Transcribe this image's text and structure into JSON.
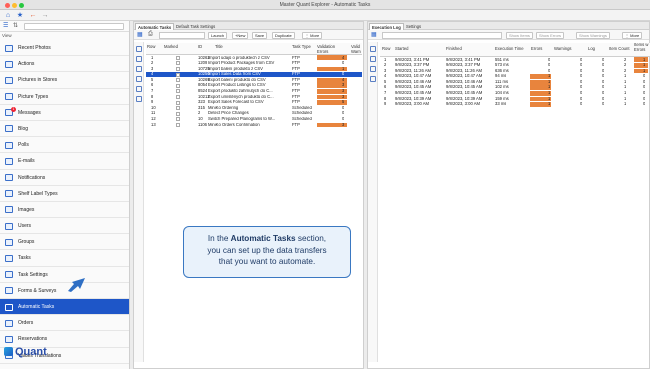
{
  "window": {
    "title": "Master Quant Explorer - Automatic Tasks"
  },
  "sidebar": {
    "view_label": "View",
    "items": [
      {
        "label": "Recent Photos",
        "icon": "photos-icon"
      },
      {
        "label": "Actions",
        "icon": "actions-icon"
      },
      {
        "label": "Pictures in Stores",
        "icon": "store-pictures-icon"
      },
      {
        "label": "Picture Types",
        "icon": "picture-types-icon"
      },
      {
        "label": "Messages",
        "icon": "messages-icon",
        "badge": "1"
      },
      {
        "label": "Blog",
        "icon": "blog-icon"
      },
      {
        "label": "Polls",
        "icon": "polls-icon"
      },
      {
        "label": "E-mails",
        "icon": "email-icon"
      },
      {
        "label": "Notifications",
        "icon": "notifications-icon"
      },
      {
        "label": "Shelf Label Types",
        "icon": "shelf-label-icon"
      },
      {
        "label": "Images",
        "icon": "images-icon"
      },
      {
        "label": "Users",
        "icon": "users-icon"
      },
      {
        "label": "Groups",
        "icon": "groups-icon"
      },
      {
        "label": "Tasks",
        "icon": "tasks-icon"
      },
      {
        "label": "Task Settings",
        "icon": "task-settings-icon"
      },
      {
        "label": "Forms & Surveys",
        "icon": "forms-icon"
      },
      {
        "label": "Automatic Tasks",
        "icon": "automatic-tasks-icon",
        "active": true
      },
      {
        "label": "Orders",
        "icon": "orders-icon"
      },
      {
        "label": "Reservations",
        "icon": "reservations-icon"
      },
      {
        "label": "Values Translations",
        "icon": "translations-icon"
      }
    ],
    "logo_text": "Quant"
  },
  "middle": {
    "tabs": [
      "Automatic Tasks",
      "Default Task Settings"
    ],
    "toolbar": {
      "launch": "Launch",
      "new": "New",
      "save": "Save",
      "duplicate": "Duplicate",
      "more": "More"
    },
    "columns": {
      "row": "Row",
      "marked": "Marked",
      "id": "ID",
      "title": "Title",
      "task_type": "Task Type",
      "validation_errors": "Validation Errors",
      "valid_warn": "Valid Warn"
    },
    "rows": [
      {
        "row": "1",
        "id": "10262",
        "title": "Import údajů o produktech z CSV",
        "type": "FTP",
        "errors": "4"
      },
      {
        "row": "2",
        "id": "1209",
        "title": "Import Product Packages from CSV",
        "type": "FTP",
        "errors": "0"
      },
      {
        "row": "3",
        "id": "10725",
        "title": "Import balení produktů z CSV",
        "type": "FTP",
        "errors": "1"
      },
      {
        "row": "4",
        "id": "10250",
        "title": "Import Sales Data from CSV",
        "type": "FTP",
        "errors": "0",
        "selected": true
      },
      {
        "row": "5",
        "id": "10269",
        "title": "Export balení produktů do CSV",
        "type": "FTP",
        "errors": "4"
      },
      {
        "row": "6",
        "id": "8054",
        "title": "Export Product Listings to CSV",
        "type": "FTP",
        "errors": "3"
      },
      {
        "row": "7",
        "id": "8524",
        "title": "Export produktů zahrnutých do C...",
        "type": "FTP",
        "errors": "3"
      },
      {
        "row": "8",
        "id": "10212",
        "title": "Export umístěných produktů do C...",
        "type": "FTP",
        "errors": "3"
      },
      {
        "row": "9",
        "id": "323",
        "title": "Export Sales Forecast to CSV",
        "type": "FTP",
        "errors": "5"
      },
      {
        "row": "10",
        "id": "315",
        "title": "MiniKo Ordering",
        "type": "Scheduled",
        "errors": "0"
      },
      {
        "row": "11",
        "id": "2",
        "title": "Detect Price Changes",
        "type": "Scheduled",
        "errors": "0"
      },
      {
        "row": "12",
        "id": "10",
        "title": "Switch Prepared Planograms to W...",
        "type": "Scheduled",
        "errors": "0"
      },
      {
        "row": "13",
        "id": "1106",
        "title": "MiniKo Orders Confirmation",
        "type": "FTP",
        "errors": "3"
      }
    ]
  },
  "right": {
    "tabs": [
      "Execution Log",
      "Settings"
    ],
    "toolbar": {
      "show_items": "Show Items",
      "show_errors": "Show Errors",
      "show_warnings": "Show Warnings",
      "more": "More"
    },
    "columns": {
      "row": "Row",
      "started": "Started",
      "finished": "Finished",
      "execution_time": "Execution Time",
      "errors": "Errors",
      "warnings": "Warnings",
      "log": "Log",
      "item_count": "Item Count",
      "items_with_errors": "Items w Errors"
    },
    "rows": [
      {
        "row": "1",
        "started": "9/8/2023, 3:41 PM",
        "finished": "9/8/2023, 3:41 PM",
        "time": "551 ms",
        "errors": "0",
        "warnings": "0",
        "log": "0",
        "items": "2",
        "item_err": "1"
      },
      {
        "row": "2",
        "started": "9/8/2023, 3:37 PM",
        "finished": "9/8/2023, 3:37 PM",
        "time": "573 ms",
        "errors": "0",
        "warnings": "0",
        "log": "0",
        "items": "2",
        "item_err": "1"
      },
      {
        "row": "3",
        "started": "9/8/2023, 11:26 AM",
        "finished": "9/8/2023, 11:26 AM",
        "time": "636 ms",
        "errors": "0",
        "warnings": "0",
        "log": "0",
        "items": "2",
        "item_err": "1"
      },
      {
        "row": "4",
        "started": "9/8/2023, 10:47 AM",
        "finished": "9/8/2023, 10:47 AM",
        "time": "94 ms",
        "errors": "1",
        "warnings": "0",
        "log": "0",
        "items": "1",
        "item_err": "0"
      },
      {
        "row": "5",
        "started": "9/8/2023, 10:46 AM",
        "finished": "9/8/2023, 10:46 AM",
        "time": "111 ms",
        "errors": "1",
        "warnings": "0",
        "log": "0",
        "items": "1",
        "item_err": "0"
      },
      {
        "row": "6",
        "started": "9/8/2023, 10:45 AM",
        "finished": "9/8/2023, 10:45 AM",
        "time": "102 ms",
        "errors": "1",
        "warnings": "0",
        "log": "0",
        "items": "1",
        "item_err": "0"
      },
      {
        "row": "7",
        "started": "9/8/2023, 10:45 AM",
        "finished": "9/8/2023, 10:45 AM",
        "time": "104 ms",
        "errors": "1",
        "warnings": "0",
        "log": "0",
        "items": "1",
        "item_err": "0"
      },
      {
        "row": "8",
        "started": "9/8/2023, 10:39 AM",
        "finished": "9/8/2023, 10:39 AM",
        "time": "159 ms",
        "errors": "1",
        "warnings": "0",
        "log": "0",
        "items": "1",
        "item_err": "0"
      },
      {
        "row": "9",
        "started": "9/8/2023, 3:00 AM",
        "finished": "9/8/2023, 3:00 AM",
        "time": "33 ms",
        "errors": "1",
        "warnings": "0",
        "log": "0",
        "items": "1",
        "item_err": "0"
      }
    ]
  },
  "callout": {
    "prefix": "In the ",
    "highlight": "Automatic Tasks",
    "suffix": " section,",
    "line2": "you can set up the data transfers",
    "line3": "that you want to automate."
  },
  "colors": {
    "accent": "#1e56c8",
    "error_bar": "#e8843d",
    "callout_border": "#3a78c2"
  }
}
